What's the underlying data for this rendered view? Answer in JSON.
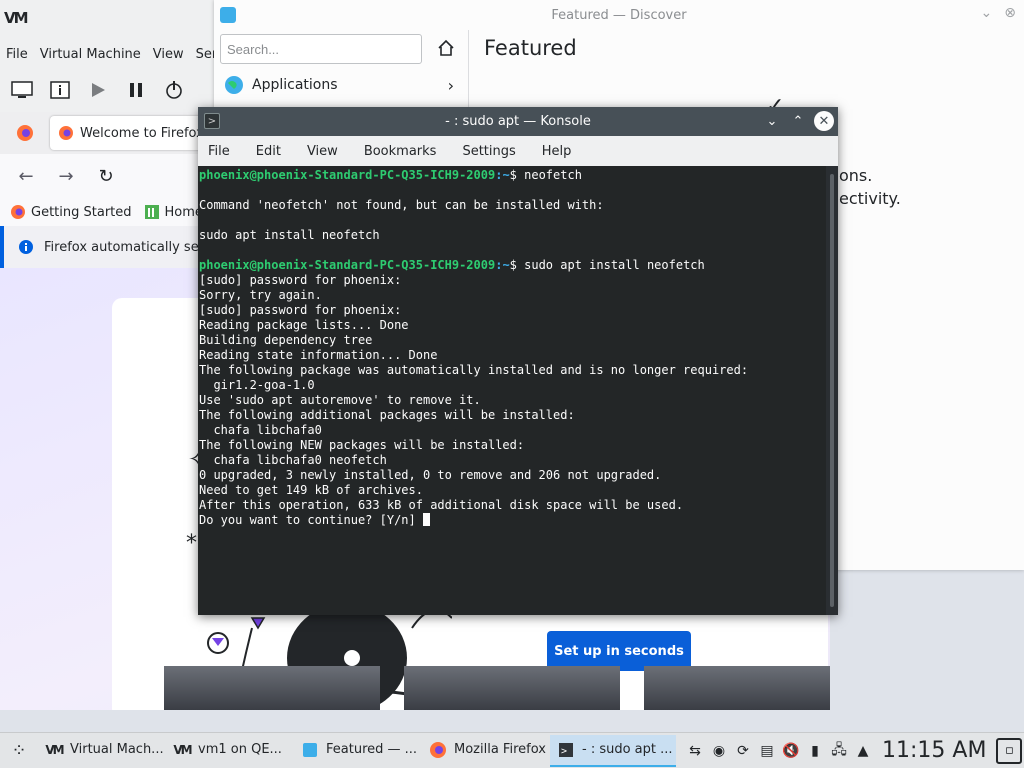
{
  "vmm": {
    "menu": [
      "File",
      "Virtual Machine",
      "View",
      "Send"
    ]
  },
  "firefox": {
    "tab_title": "Welcome to Firefox",
    "bookmarks": [
      "Getting Started",
      "Home"
    ],
    "notice": "Firefox automatically sen",
    "setup_button": "Set up in seconds"
  },
  "discover": {
    "title": "Featured — Discover",
    "search_placeholder": "Search...",
    "sidebar_item": "Applications",
    "heading": "Featured",
    "text_1": "ons.",
    "text_2": "ectivity."
  },
  "konsole": {
    "title": "- : sudo apt — Konsole",
    "menu": [
      "File",
      "Edit",
      "View",
      "Bookmarks",
      "Settings",
      "Help"
    ],
    "prompt_user": "phoenix@phoenix-Standard-PC-Q35-ICH9-2009",
    "prompt_path": ":~",
    "lines": [
      {
        "prompt": true,
        "cmd": "$ neofetch"
      },
      {
        "text": ""
      },
      {
        "text": "Command 'neofetch' not found, but can be installed with:"
      },
      {
        "text": ""
      },
      {
        "text": "sudo apt install neofetch"
      },
      {
        "text": ""
      },
      {
        "prompt": true,
        "cmd": "$ sudo apt install neofetch"
      },
      {
        "text": "[sudo] password for phoenix:"
      },
      {
        "text": "Sorry, try again."
      },
      {
        "text": "[sudo] password for phoenix:"
      },
      {
        "text": "Reading package lists... Done"
      },
      {
        "text": "Building dependency tree"
      },
      {
        "text": "Reading state information... Done"
      },
      {
        "text": "The following package was automatically installed and is no longer required:"
      },
      {
        "text": "  gir1.2-goa-1.0"
      },
      {
        "text": "Use 'sudo apt autoremove' to remove it."
      },
      {
        "text": "The following additional packages will be installed:"
      },
      {
        "text": "  chafa libchafa0"
      },
      {
        "text": "The following NEW packages will be installed:"
      },
      {
        "text": "  chafa libchafa0 neofetch"
      },
      {
        "text": "0 upgraded, 3 newly installed, 0 to remove and 206 not upgraded."
      },
      {
        "text": "Need to get 149 kB of archives."
      },
      {
        "text": "After this operation, 633 kB of additional disk space will be used."
      },
      {
        "text": "Do you want to continue? [Y/n] ",
        "cursor": true
      }
    ]
  },
  "taskbar": {
    "tasks": [
      {
        "label": "Virtual Mach...",
        "icon": "vm-icon",
        "active": false
      },
      {
        "label": "vm1 on QE...",
        "icon": "vm-icon",
        "active": false
      },
      {
        "label": "Featured — ...",
        "icon": "discover-icon",
        "active": false
      },
      {
        "label": "Mozilla Firefox",
        "icon": "firefox-icon",
        "active": false
      },
      {
        "label": "- : sudo apt ...",
        "icon": "konsole-icon",
        "active": true
      }
    ],
    "clock": "11:15 AM"
  }
}
